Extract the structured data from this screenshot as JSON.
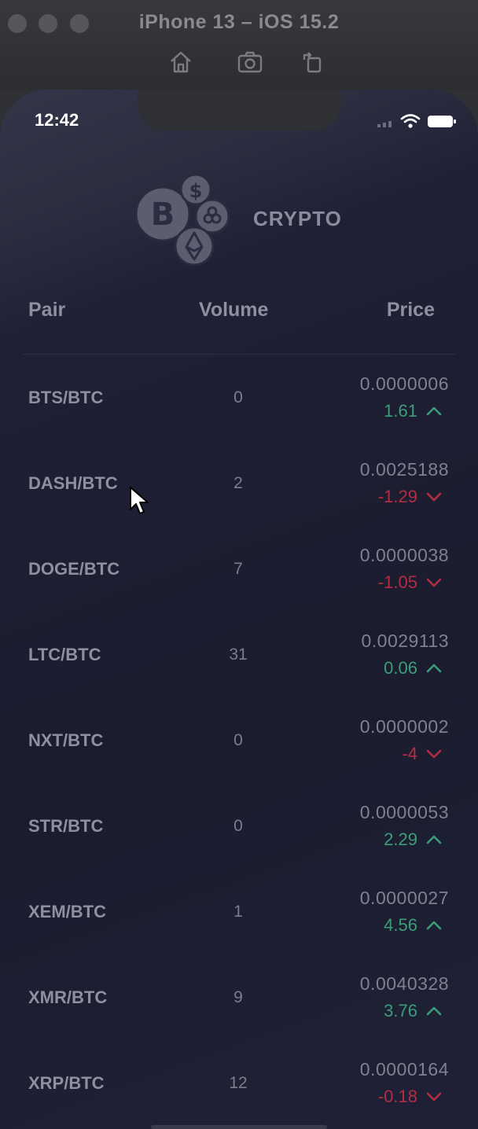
{
  "simulator": {
    "title": "iPhone 13 – iOS 15.2",
    "tools": [
      "home-icon",
      "screenshot-icon",
      "rotate-icon"
    ]
  },
  "status_bar": {
    "time": "12:42"
  },
  "app": {
    "brand": "CRYPTO"
  },
  "table": {
    "headers": {
      "pair": "Pair",
      "volume": "Volume",
      "price": "Price"
    },
    "rows": [
      {
        "pair": "BTS/BTC",
        "volume": "0",
        "price": "0.0000006",
        "change": "1.61",
        "direction": "up"
      },
      {
        "pair": "DASH/BTC",
        "volume": "2",
        "price": "0.0025188",
        "change": "-1.29",
        "direction": "down"
      },
      {
        "pair": "DOGE/BTC",
        "volume": "7",
        "price": "0.0000038",
        "change": "-1.05",
        "direction": "down"
      },
      {
        "pair": "LTC/BTC",
        "volume": "31",
        "price": "0.0029113",
        "change": "0.06",
        "direction": "up"
      },
      {
        "pair": "NXT/BTC",
        "volume": "0",
        "price": "0.0000002",
        "change": "-4",
        "direction": "down"
      },
      {
        "pair": "STR/BTC",
        "volume": "0",
        "price": "0.0000053",
        "change": "2.29",
        "direction": "up"
      },
      {
        "pair": "XEM/BTC",
        "volume": "1",
        "price": "0.0000027",
        "change": "4.56",
        "direction": "up"
      },
      {
        "pair": "XMR/BTC",
        "volume": "9",
        "price": "0.0040328",
        "change": "3.76",
        "direction": "up"
      },
      {
        "pair": "XRP/BTC",
        "volume": "12",
        "price": "0.0000164",
        "change": "-0.18",
        "direction": "down"
      }
    ]
  },
  "colors": {
    "positive": "#3d9c7a",
    "negative": "#b52c44",
    "background": "#1e1f33"
  }
}
